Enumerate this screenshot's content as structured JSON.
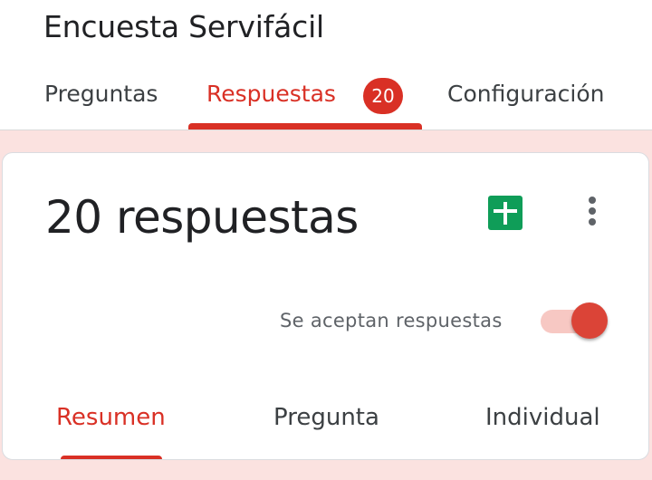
{
  "header": {
    "title": "Encuesta Servifácil",
    "tabs": [
      {
        "label": "Preguntas",
        "active": false
      },
      {
        "label": "Respuestas",
        "active": true,
        "badge": "20"
      },
      {
        "label": "Configuración",
        "active": false
      }
    ]
  },
  "summary": {
    "count_label": "20 respuestas",
    "accepting_label": "Se aceptan respuestas",
    "accepting": true,
    "sheets_icon": "google-sheets-icon",
    "more_icon": "more-vert-icon",
    "subtabs": [
      {
        "label": "Resumen",
        "active": true
      },
      {
        "label": "Pregunta",
        "active": false
      },
      {
        "label": "Individual",
        "active": false
      }
    ]
  },
  "colors": {
    "accent": "#d93025",
    "background_tint": "#fbe2e0",
    "sheets_green": "#0f9d58"
  }
}
